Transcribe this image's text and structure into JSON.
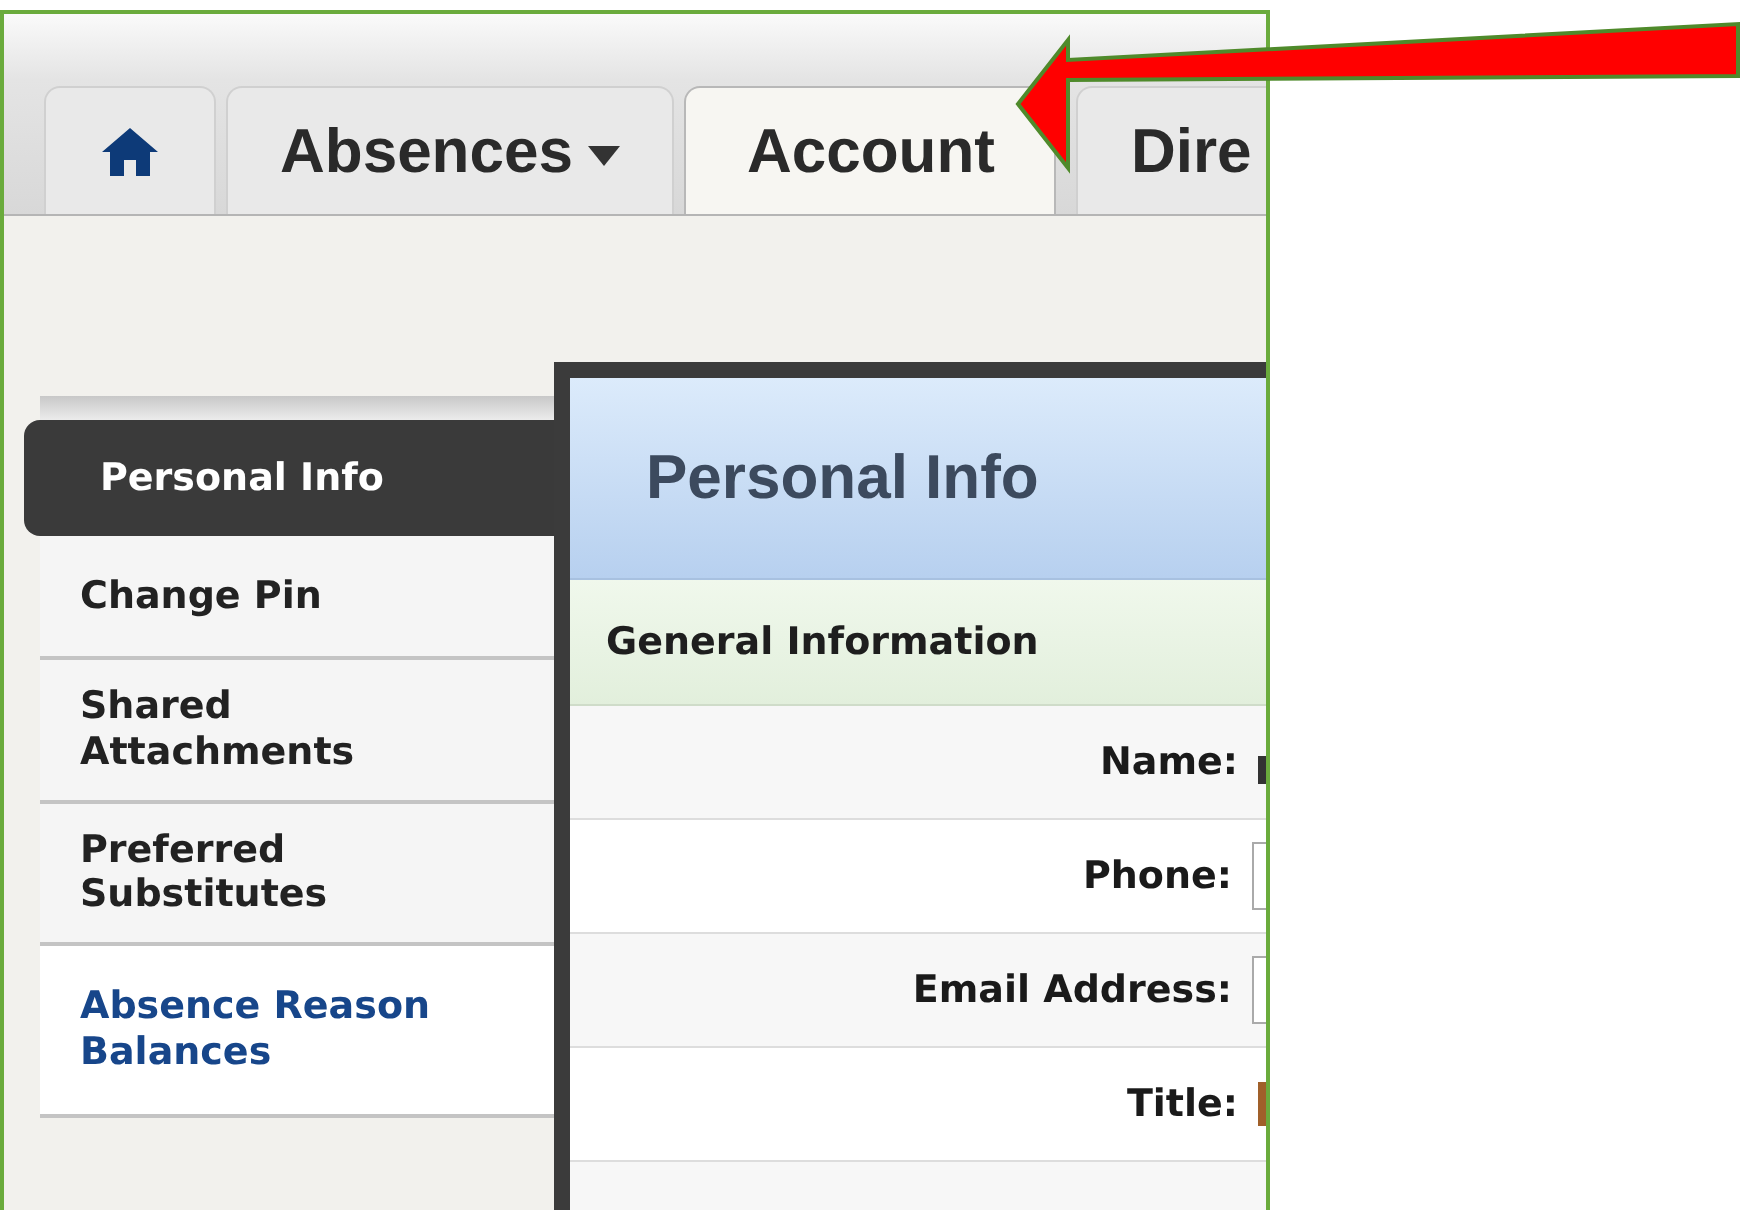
{
  "tabs": [
    {
      "kind": "home",
      "selected": false
    },
    {
      "kind": "menu",
      "label": "Absences",
      "selected": false
    },
    {
      "kind": "plain",
      "label": "Account",
      "selected": true
    },
    {
      "kind": "plain",
      "label": "Dire",
      "selected": false
    }
  ],
  "sidebar": {
    "items": [
      {
        "label": "Personal Info",
        "selected": true,
        "highlighted": false
      },
      {
        "label": "Change Pin",
        "selected": false,
        "highlighted": false
      },
      {
        "label": "Shared Attachments",
        "selected": false,
        "highlighted": false
      },
      {
        "label": "Preferred Substitutes",
        "selected": false,
        "highlighted": false
      },
      {
        "label": "Absence Reason Balances",
        "selected": false,
        "highlighted": true
      }
    ]
  },
  "panel": {
    "title": "Personal Info",
    "section": "General Information",
    "fields": [
      {
        "label": "Name:",
        "kind": "text"
      },
      {
        "label": "Phone:",
        "kind": "input"
      },
      {
        "label": "Email Address:",
        "kind": "input"
      },
      {
        "label": "Title:",
        "kind": "select"
      }
    ]
  }
}
